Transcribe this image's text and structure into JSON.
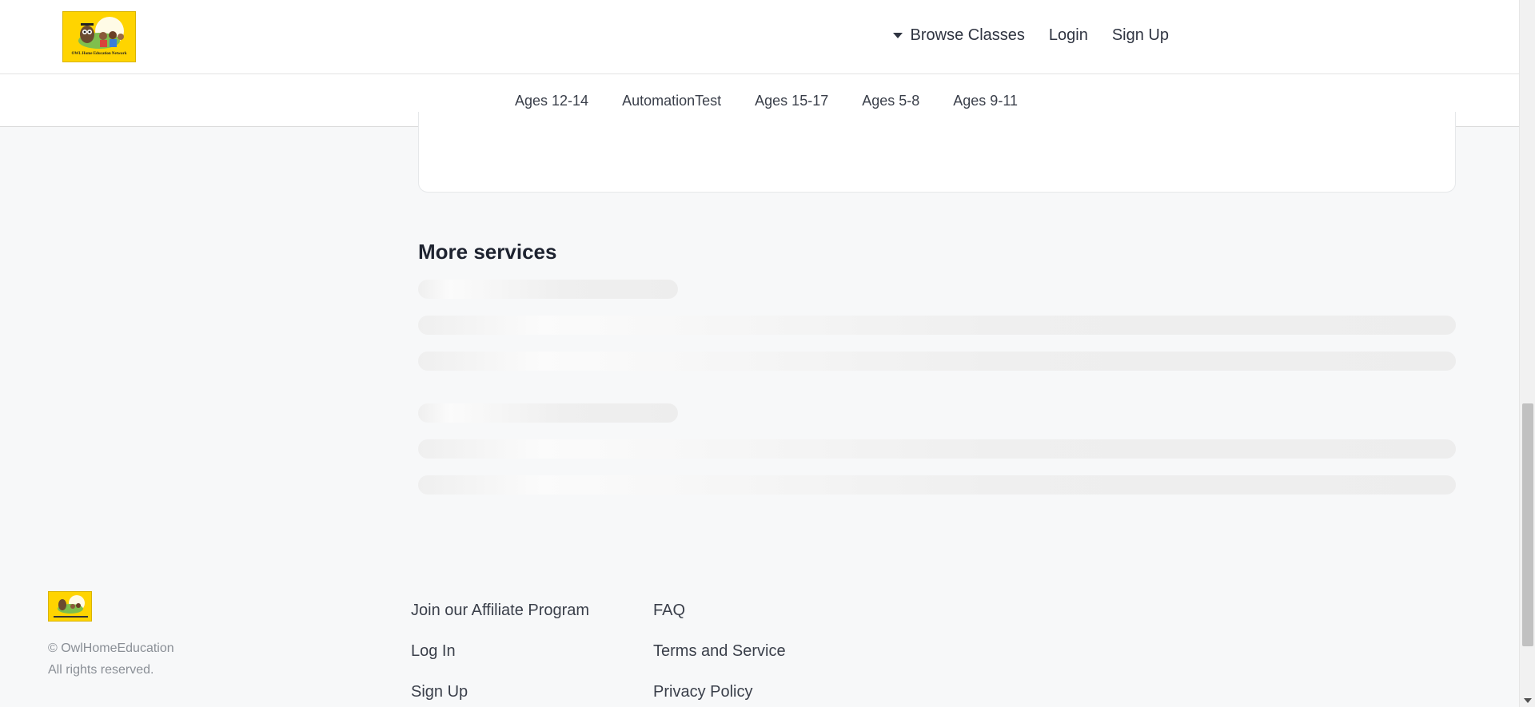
{
  "header": {
    "logo_text": "OWL Home Education Network",
    "browse_label": "Browse Classes",
    "login_label": "Login",
    "signup_label": "Sign Up"
  },
  "categories": [
    "Ages 12-14",
    "AutomationTest",
    "Ages 15-17",
    "Ages 5-8",
    "Ages 9-11"
  ],
  "main": {
    "section_title": "More services"
  },
  "footer": {
    "copyright_line1": "© OwlHomeEducation",
    "copyright_line2": "All rights reserved.",
    "col1": [
      "Join our Affiliate Program",
      "Log In",
      "Sign Up"
    ],
    "col2": [
      "FAQ",
      "Terms and Service",
      "Privacy Policy"
    ]
  },
  "colors": {
    "brand_yellow": "#ffd400",
    "background": "#f7f8f9",
    "text": "#2f3441"
  }
}
